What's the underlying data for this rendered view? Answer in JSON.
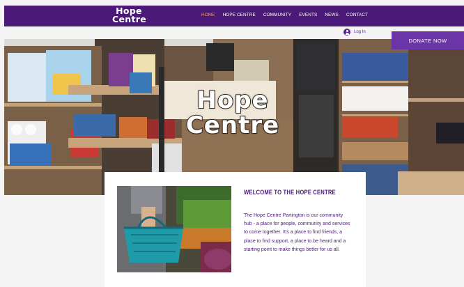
{
  "header": {
    "logo_line1": "Hope",
    "logo_line2": "Centre",
    "nav": [
      {
        "label": "HOME",
        "active": true
      },
      {
        "label": "HOPE CENTRE",
        "active": false
      },
      {
        "label": "COMMUNITY",
        "active": false
      },
      {
        "label": "EVENTS",
        "active": false
      },
      {
        "label": "NEWS",
        "active": false
      },
      {
        "label": "CONTACT",
        "active": false
      }
    ],
    "login_label": "Log In",
    "donate_label": "DONATE NOW"
  },
  "hero": {
    "title_line1": "Hope",
    "title_line2": "Centre"
  },
  "welcome": {
    "title": "WELCOME TO THE HOPE CENTRE",
    "body": "The Hope Centre Partington is our community hub - a place for people, community and services to come together. It's a place to find friends, a place to find support, a place to be heard and a starting point to make things better for us all."
  },
  "colors": {
    "brand_purple": "#4b1978",
    "donate_purple": "#6b35a8",
    "nav_active": "#f0a04b"
  }
}
